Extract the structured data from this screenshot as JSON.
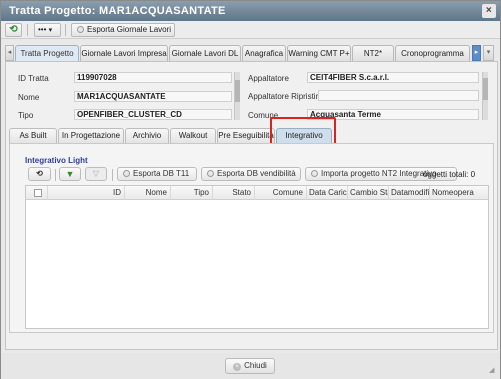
{
  "window": {
    "title": "Tratta Progetto: MAR1ACQUASANTATE",
    "close_glyph": "×"
  },
  "toolbar": {
    "refresh_icon": "refresh-icon",
    "more_label": "•••",
    "more_caret": "▾",
    "export_label": "Esporta Giornale Lavori"
  },
  "main_tabs": [
    {
      "label": "Tratta Progetto",
      "active": true
    },
    {
      "label": "Giornale Lavori Impresa",
      "active": false
    },
    {
      "label": "Giornale Lavori DL",
      "active": false
    },
    {
      "label": "Anagrafica",
      "active": false
    },
    {
      "label": "Warning CMT P+",
      "active": false
    },
    {
      "label": "NT2*",
      "active": false
    },
    {
      "label": "Cronoprogramma",
      "active": false
    }
  ],
  "form": {
    "left": [
      {
        "label": "ID Tratta",
        "value": "119907028"
      },
      {
        "label": "Nome",
        "value": "MAR1ACQUASANTATE"
      },
      {
        "label": "Tipo",
        "value": "OPENFIBER_CLUSTER_CD"
      }
    ],
    "right": [
      {
        "label": "Appaltatore",
        "value": "CEIT4FIBER S.c.a.r.l."
      },
      {
        "label": "Appaltatore Ripristini",
        "value": ""
      },
      {
        "label": "Comune",
        "value": "Acquasanta Terme"
      }
    ]
  },
  "sub_tabs": [
    {
      "label": "As Built",
      "active": false
    },
    {
      "label": "In Progettazione",
      "active": false
    },
    {
      "label": "Archivio",
      "active": false
    },
    {
      "label": "Walkout",
      "active": false
    },
    {
      "label": "Pre Eseguibilità",
      "active": false
    },
    {
      "label": "Integrativo",
      "active": true
    }
  ],
  "integrativo": {
    "title": "Integrativo Light",
    "buttons": {
      "export_t11": "Esporta DB T11",
      "export_vendibilita": "Esporta DB vendibilità",
      "import_nt2": "Importa progetto NT2 Integrativo"
    },
    "totali": "oggetti totali: 0",
    "columns": [
      "ID",
      "Nome",
      "Tipo",
      "Stato",
      "Comune",
      "Data Carica",
      "Cambio Sta",
      "Datamodific",
      "Nomeopera"
    ]
  },
  "footer": {
    "close_label": "Chiudi"
  }
}
